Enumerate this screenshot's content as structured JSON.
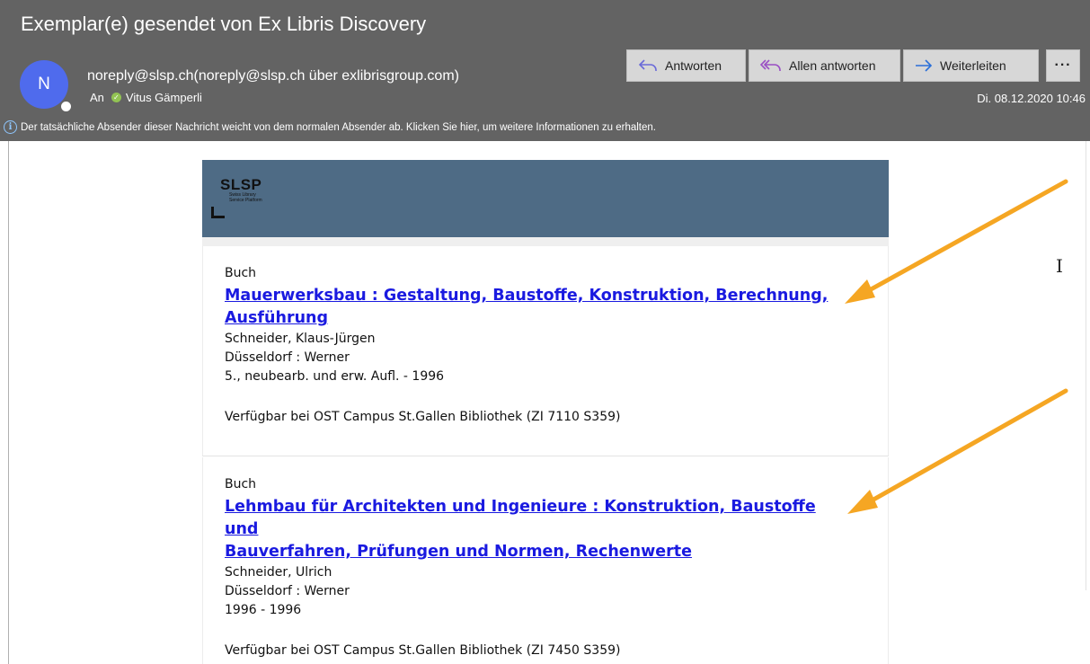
{
  "header": {
    "subject": "Exemplar(e) gesendet von Ex Libris Discovery",
    "avatar_initial": "N",
    "sender": "noreply@slsp.ch(noreply@slsp.ch über exlibrisgroup.com)",
    "to_label": "An",
    "recipient": "Vitus Gämperli",
    "date": "Di. 08.12.2020 10:46",
    "info_notice": "Der tatsächliche Absender dieser Nachricht weicht von dem normalen Absender ab. Klicken Sie hier, um weitere Informationen zu erhalten."
  },
  "actions": {
    "reply": "Antworten",
    "reply_all": "Allen antworten",
    "forward": "Weiterleiten",
    "more": "···"
  },
  "banner": {
    "logo_text": "SLSP",
    "logo_sub_line1": "Swiss Library",
    "logo_sub_line2": "Service Platform"
  },
  "items": [
    {
      "type": "Buch",
      "title_line1": "Mauerwerksbau : Gestaltung, Baustoffe, Konstruktion, Berechnung,",
      "title_line2": "Ausführung",
      "author": "Schneider, Klaus-Jürgen",
      "publisher": "Düsseldorf : Werner",
      "edition": "5., neubearb. und erw. Aufl. - 1996",
      "availability": "Verfügbar bei OST Campus St.Gallen Bibliothek (ZI 7110 S359)"
    },
    {
      "type": "Buch",
      "title_line1": "Lehmbau für Architekten und Ingenieure : Konstruktion, Baustoffe und",
      "title_line2": "Bauverfahren, Prüfungen und Normen, Rechenwerte",
      "author": "Schneider, Ulrich",
      "publisher": "Düsseldorf : Werner",
      "edition": "1996 - 1996",
      "availability": "Verfügbar bei OST Campus St.Gallen Bibliothek (ZI 7450 S359)"
    }
  ],
  "colors": {
    "header_bg": "#636363",
    "avatar_bg": "#4f6bed",
    "banner_bg": "#4e6b85",
    "link": "#1a1ae0",
    "annotation_arrow": "#f5a623"
  },
  "icons": {
    "reply": "reply-arrow-icon",
    "reply_all": "reply-all-arrow-icon",
    "forward": "forward-arrow-icon",
    "more": "ellipsis-icon",
    "info": "info-icon",
    "presence": "presence-available-icon",
    "cursor": "text-cursor-icon"
  }
}
